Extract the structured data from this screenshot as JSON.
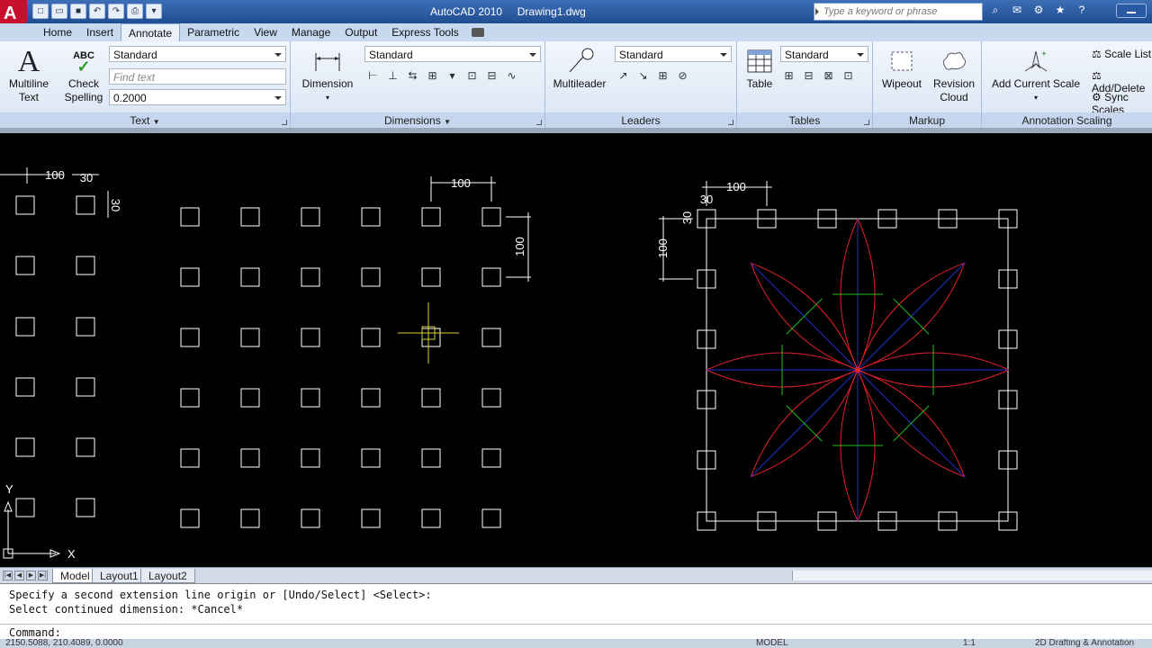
{
  "title_bar": {
    "app_title": "AutoCAD 2010",
    "document": "Drawing1.dwg",
    "search_placeholder": "Type a keyword or phrase",
    "app_letter": "A"
  },
  "ribbon_tabs": [
    "Home",
    "Insert",
    "Annotate",
    "Parametric",
    "View",
    "Manage",
    "Output",
    "Express Tools"
  ],
  "active_tab": "Annotate",
  "panels": {
    "text": {
      "title": "Text",
      "multiline_label_1": "Multiline",
      "multiline_label_2": "Text",
      "check_label_1": "Check",
      "check_label_2": "Spelling",
      "abc": "ABC",
      "style": "Standard",
      "find_placeholder": "Find text",
      "height": "0.2000"
    },
    "dimensions": {
      "title": "Dimensions",
      "dimension_label": "Dimension",
      "style": "Standard"
    },
    "leaders": {
      "title": "Leaders",
      "multileader_label": "Multileader",
      "style": "Standard"
    },
    "tables": {
      "title": "Tables",
      "table_label": "Table",
      "style": "Standard"
    },
    "markup": {
      "title": "Markup",
      "wipeout_label": "Wipeout",
      "revision_label_1": "Revision",
      "revision_label_2": "Cloud"
    },
    "annotation_scaling": {
      "title": "Annotation Scaling",
      "add_current_scale_1": "Add Current Scale",
      "scale_list": "Scale List",
      "add_delete": "Add/Delete",
      "sync_scales": "Sync Scales"
    }
  },
  "drawing": {
    "dimensions": {
      "spacing": "100",
      "offset": "30"
    },
    "ucs": {
      "x_label": "X",
      "y_label": "Y"
    }
  },
  "layout_tabs": [
    "Model",
    "Layout1",
    "Layout2"
  ],
  "active_layout": "Model",
  "command_history": [
    "Specify a second extension line origin or [Undo/Select] <Select>:",
    "Select continued dimension: *Cancel*"
  ],
  "command_prompt": "Command:",
  "status_bar": {
    "coords": "2150.5088, 210.4089, 0.0000",
    "model": "MODEL",
    "scale": "1:1",
    "workspace": "2D Drafting & Annotation"
  },
  "colors": {
    "petal": "#e0202a",
    "axis": "#2030d0",
    "green": "#20c020",
    "geometry": "#ffffff",
    "cursor": "#d8d040"
  }
}
